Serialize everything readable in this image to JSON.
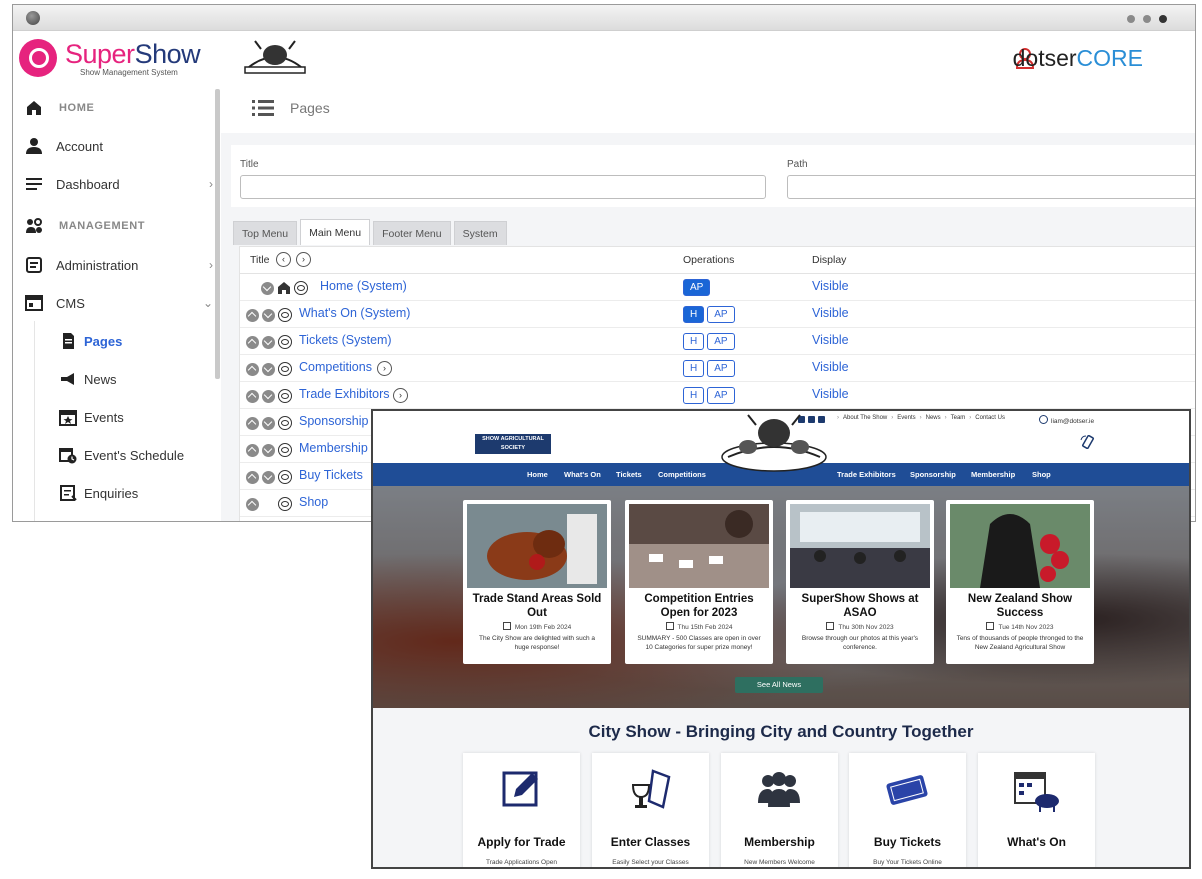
{
  "header": {
    "brand_left": "Super",
    "brand_right": "Show",
    "brand_tagline": "Show Management System",
    "core_left": "dotser",
    "core_right": "CORE"
  },
  "sidebar": {
    "items": [
      {
        "label": "HOME",
        "icon": "home-icon"
      },
      {
        "label": "Account",
        "icon": "person-icon"
      },
      {
        "label": "Dashboard",
        "icon": "list-icon"
      },
      {
        "label": "MANAGEMENT",
        "icon": "management-icon"
      },
      {
        "label": "Administration",
        "icon": "admin-icon"
      },
      {
        "label": "CMS",
        "icon": "cms-icon"
      },
      {
        "label": "Pages",
        "icon": "page-icon"
      },
      {
        "label": "News",
        "icon": "megaphone-icon"
      },
      {
        "label": "Events",
        "icon": "calendar-star-icon"
      },
      {
        "label": "Event's Schedule",
        "icon": "calendar-clock-icon"
      },
      {
        "label": "Enquiries",
        "icon": "enquiries-icon"
      }
    ]
  },
  "main": {
    "page_title": "Pages",
    "filter_title_label": "Title",
    "filter_path_label": "Path",
    "tabs": [
      "Top Menu",
      "Main Menu",
      "Footer Menu",
      "System"
    ],
    "columns": {
      "title": "Title",
      "operations": "Operations",
      "display": "Display"
    },
    "rows": [
      {
        "name": "Home (System)",
        "ops": [
          "AP"
        ],
        "display": "Visible"
      },
      {
        "name": "What's On (System)",
        "ops": [
          "H",
          "AP"
        ],
        "display": "Visible"
      },
      {
        "name": "Tickets (System)",
        "ops": [
          "H",
          "AP"
        ],
        "display": "Visible"
      },
      {
        "name": "Competitions",
        "ops": [
          "H",
          "AP"
        ],
        "display": "Visible"
      },
      {
        "name": "Trade Exhibitors",
        "ops": [
          "H",
          "AP"
        ],
        "display": "Visible"
      },
      {
        "name": "Sponsorship",
        "ops": [],
        "display": ""
      },
      {
        "name": "Membership",
        "ops": [],
        "display": ""
      },
      {
        "name": "Buy Tickets",
        "ops": [],
        "display": ""
      },
      {
        "name": "Shop",
        "ops": [],
        "display": ""
      }
    ]
  },
  "site": {
    "badge": "SHOW AGRICULTURAL SOCIETY",
    "toplinks": [
      "About The Show",
      "Events",
      "News",
      "Team",
      "Contact Us"
    ],
    "email": "liam@dotser.ie",
    "nav": [
      "Home",
      "What's On",
      "Tickets",
      "Competitions",
      "Trade Exhibitors",
      "Sponsorship",
      "Membership",
      "Shop"
    ],
    "news": [
      {
        "title": "Trade Stand Areas Sold Out",
        "date": "Mon 19th Feb 2024",
        "summary": "The City Show are delighted with such a huge response!"
      },
      {
        "title": "Competition Entries Open for 2023",
        "date": "Thu 15th Feb 2024",
        "summary": "SUMMARY - 500 Classes are open in over 10 Categories for super prize money!"
      },
      {
        "title": "SuperShow Shows at ASAO",
        "date": "Thu 30th Nov 2023",
        "summary": "Browse through our photos at this year's conference."
      },
      {
        "title": "New Zealand Show Success",
        "date": "Tue 14th Nov 2023",
        "summary": "Tens of thousands of people thronged to the New Zealand Agricultural Show"
      }
    ],
    "see_all": "See All News",
    "tagline": "City Show - Bringing City and Country Together",
    "features": [
      {
        "label": "Apply for Trade",
        "sub": "Trade Applications Open",
        "icon": "edit-icon"
      },
      {
        "label": "Enter Classes",
        "sub": "Easily Select your Classes",
        "icon": "trophy-icon"
      },
      {
        "label": "Membership",
        "sub": "New Members Welcome",
        "icon": "people-icon"
      },
      {
        "label": "Buy Tickets",
        "sub": "Buy Your Tickets Online",
        "icon": "ticket-icon"
      },
      {
        "label": "What's On",
        "sub": "",
        "icon": "calendar-cow-icon"
      }
    ]
  }
}
